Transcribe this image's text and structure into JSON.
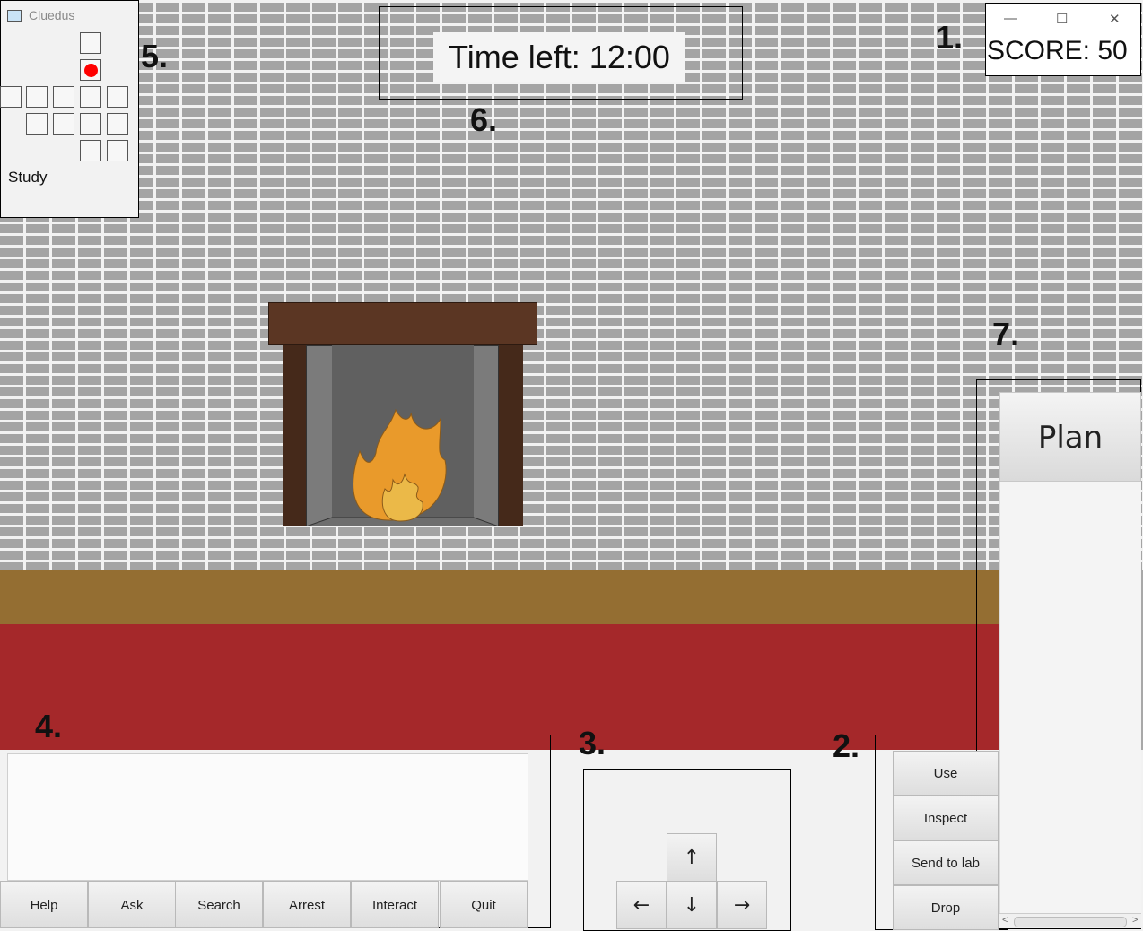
{
  "window": {
    "title": "Cluedus",
    "icon": "app-icon",
    "minimize": "—",
    "maximize": "☐",
    "close": "✕"
  },
  "score": {
    "label": "SCORE: 50"
  },
  "timer": {
    "label": "Time left: 12:00"
  },
  "map": {
    "room": "Study",
    "current_room_icon": "red-dot"
  },
  "markers": {
    "m1": "1.",
    "m2": "2.",
    "m3": "3.",
    "m4": "4.",
    "m5": "5.",
    "m6": "6.",
    "m7": "7."
  },
  "plan": {
    "label": "Plan"
  },
  "log": {
    "text": ""
  },
  "commands": [
    "Help",
    "Ask",
    "Search",
    "Arrest",
    "Interact",
    "Quit"
  ],
  "movement": {
    "up": "↑",
    "left": "←",
    "down": "↓",
    "right": "→"
  },
  "items": [
    "Use",
    "Inspect",
    "Send to lab",
    "Drop"
  ],
  "scroll": {
    "left": "<",
    "right": ">"
  },
  "colors": {
    "brick": "#a4a4a4",
    "mortar": "#f2f2f2",
    "floor": "#946e32",
    "rug": "#a5282a",
    "fireplace": "#5b3623",
    "flame": "#e99a2b"
  }
}
